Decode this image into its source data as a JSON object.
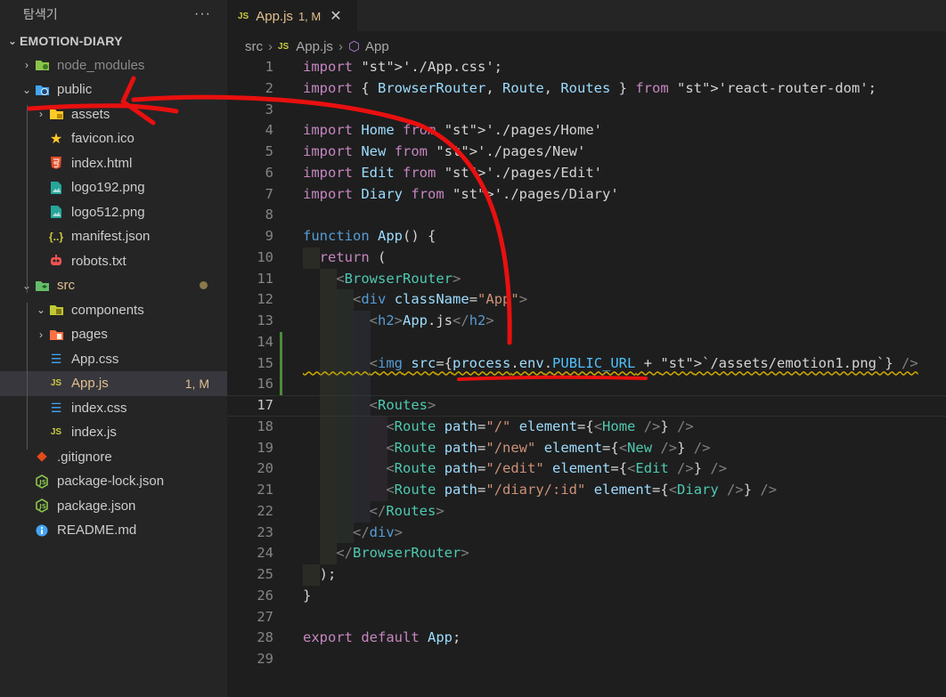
{
  "sidebar": {
    "title": "탐색기",
    "more": "···",
    "root": "EMOTION-DIARY",
    "items": [
      {
        "label": "node_modules"
      },
      {
        "label": "public"
      },
      {
        "label": "assets"
      },
      {
        "label": "favicon.ico"
      },
      {
        "label": "index.html"
      },
      {
        "label": "logo192.png"
      },
      {
        "label": "logo512.png"
      },
      {
        "label": "manifest.json"
      },
      {
        "label": "robots.txt"
      },
      {
        "label": "src"
      },
      {
        "label": "components"
      },
      {
        "label": "pages"
      },
      {
        "label": "App.css"
      },
      {
        "label": "App.js",
        "status": "1, M"
      },
      {
        "label": "index.css"
      },
      {
        "label": "index.js"
      },
      {
        "label": ".gitignore"
      },
      {
        "label": "package-lock.json"
      },
      {
        "label": "package.json"
      },
      {
        "label": "README.md"
      }
    ]
  },
  "tab": {
    "label": "App.js",
    "status": "1, M",
    "icon": "JS",
    "close": "✕"
  },
  "breadcrumb": {
    "folder": "src",
    "file": "App.js",
    "symbol": "App"
  },
  "code": {
    "lines": [
      {
        "n": "1",
        "text": "import './App.css';"
      },
      {
        "n": "2",
        "text": "import { BrowserRouter, Route, Routes } from 'react-router-dom';"
      },
      {
        "n": "3",
        "text": ""
      },
      {
        "n": "4",
        "text": "import Home from './pages/Home'"
      },
      {
        "n": "5",
        "text": "import New from './pages/New'"
      },
      {
        "n": "6",
        "text": "import Edit from './pages/Edit'"
      },
      {
        "n": "7",
        "text": "import Diary from './pages/Diary'"
      },
      {
        "n": "8",
        "text": ""
      },
      {
        "n": "9",
        "text": "function App() {"
      },
      {
        "n": "10",
        "text": "  return ("
      },
      {
        "n": "11",
        "text": "    <BrowserRouter>"
      },
      {
        "n": "12",
        "text": "      <div className=\"App\">"
      },
      {
        "n": "13",
        "text": "        <h2>App.js</h2>"
      },
      {
        "n": "14",
        "text": ""
      },
      {
        "n": "15",
        "text": "        <img src={process.env.PUBLIC_URL + `/assets/emotion1.png`} />"
      },
      {
        "n": "16",
        "text": ""
      },
      {
        "n": "17",
        "text": "        <Routes>"
      },
      {
        "n": "18",
        "text": "          <Route path=\"/\" element={<Home />} />"
      },
      {
        "n": "19",
        "text": "          <Route path=\"/new\" element={<New />} />"
      },
      {
        "n": "20",
        "text": "          <Route path=\"/edit\" element={<Edit />} />"
      },
      {
        "n": "21",
        "text": "          <Route path=\"/diary/:id\" element={<Diary />} />"
      },
      {
        "n": "22",
        "text": "        </Routes>"
      },
      {
        "n": "23",
        "text": "      </div>"
      },
      {
        "n": "24",
        "text": "    </BrowserRouter>"
      },
      {
        "n": "25",
        "text": "  );"
      },
      {
        "n": "26",
        "text": "}"
      },
      {
        "n": "27",
        "text": ""
      },
      {
        "n": "28",
        "text": "export default App;"
      },
      {
        "n": "29",
        "text": ""
      }
    ]
  },
  "colors": {
    "annotation": "#e8100f",
    "keyword": "#c586c0",
    "string": "#ce9178",
    "tag": "#4ec9b0",
    "variable": "#9cdcfe"
  },
  "icons": {
    "folder": "folder-icon",
    "js": "js-file-icon",
    "css": "css-file-icon",
    "html": "html-file-icon",
    "image": "image-file-icon",
    "json": "json-file-icon",
    "robot": "robot-icon",
    "star": "star-icon",
    "git": "git-icon",
    "info": "info-icon",
    "more": "more-icon",
    "chevron": "chevron-icon"
  }
}
